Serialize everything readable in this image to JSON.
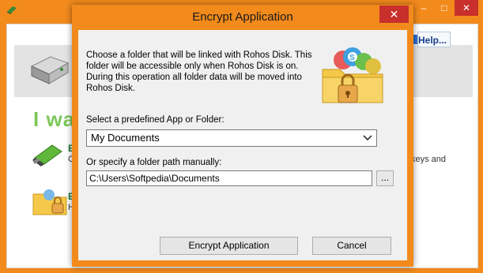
{
  "background_window": {
    "heading_partial": "I wa",
    "help_label": "Help...",
    "option1_letter": "E",
    "option1_sub": "C",
    "option2_letter": "E",
    "option2_sub": "H",
    "right_text": "keys and",
    "window_controls": {
      "minimize": "–",
      "maximize": "□",
      "close": "✕"
    }
  },
  "dialog": {
    "title": "Encrypt Application",
    "close_glyph": "✕",
    "intro_lines": [
      "Choose a folder that will be linked with Rohos Disk. This",
      "folder will be accessible only when Rohos Disk is on.",
      "During this operation all folder data will be moved into",
      "Rohos Disk."
    ],
    "select_label": "Select a predefined App or Folder:",
    "select_value": "My Documents",
    "path_label": "Or specify a folder path manually:",
    "path_value": "C:\\Users\\Softpedia\\Documents",
    "browse_label": "...",
    "encrypt_label": "Encrypt Application",
    "cancel_label": "Cancel"
  },
  "icons": [
    "app-title-icon",
    "drive-icon",
    "usb-stick-icon",
    "locked-folder-icon",
    "app-folder-icon",
    "chevron-down-icon",
    "help-icon"
  ],
  "colors": {
    "accent_orange": "#f28a1c",
    "close_red": "#c7302b",
    "heading_green": "#7dc85a"
  }
}
